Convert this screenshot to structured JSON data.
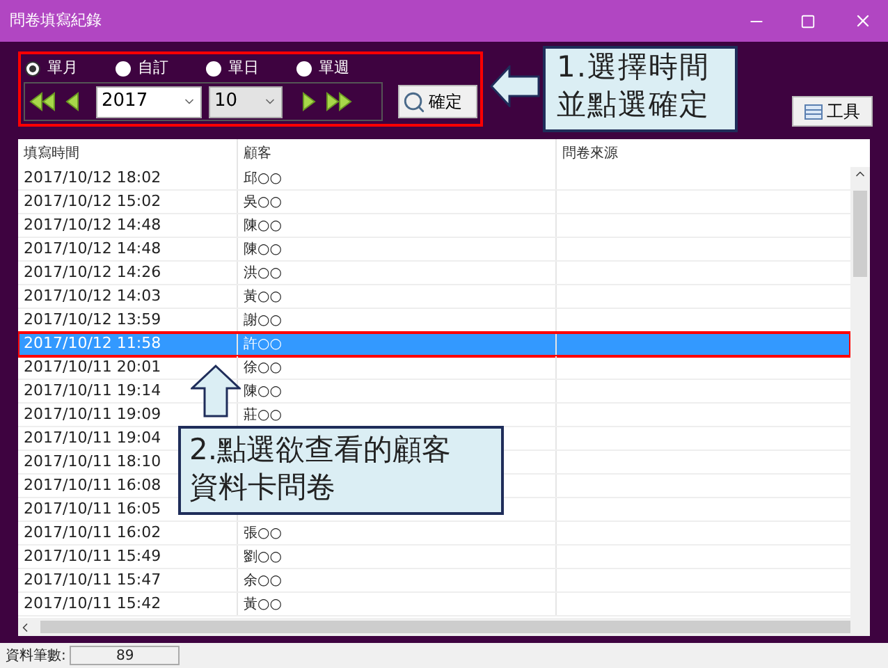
{
  "window": {
    "title": "問卷填寫紀錄"
  },
  "period_options": [
    {
      "label": "單月",
      "selected": true
    },
    {
      "label": "自訂",
      "selected": false
    },
    {
      "label": "單日",
      "selected": false
    },
    {
      "label": "單週",
      "selected": false
    }
  ],
  "year": {
    "value": "2017"
  },
  "month": {
    "value": "10"
  },
  "confirm_button": "確定",
  "tools_button": "工具",
  "table": {
    "columns": [
      "填寫時間",
      "顧客",
      "問卷來源"
    ],
    "rows": [
      {
        "time": "2017/10/12 18:02",
        "customer": "邱○○",
        "selected": false
      },
      {
        "time": "2017/10/12 15:02",
        "customer": "吳○○",
        "selected": false
      },
      {
        "time": "2017/10/12 14:48",
        "customer": "陳○○",
        "selected": false
      },
      {
        "time": "2017/10/12 14:48",
        "customer": "陳○○",
        "selected": false
      },
      {
        "time": "2017/10/12 14:26",
        "customer": "洪○○",
        "selected": false
      },
      {
        "time": "2017/10/12 14:03",
        "customer": "黃○○",
        "selected": false
      },
      {
        "time": "2017/10/12 13:59",
        "customer": "謝○○",
        "selected": false
      },
      {
        "time": "2017/10/12 11:58",
        "customer": "許○○",
        "selected": true
      },
      {
        "time": "2017/10/11 20:01",
        "customer": "徐○○",
        "selected": false
      },
      {
        "time": "2017/10/11 19:14",
        "customer": "陳○○",
        "selected": false
      },
      {
        "time": "2017/10/11 19:09",
        "customer": "莊○○",
        "selected": false
      },
      {
        "time": "2017/10/11 19:04",
        "selected": false
      },
      {
        "time": "2017/10/11 18:10",
        "selected": false
      },
      {
        "time": "2017/10/11 16:08",
        "selected": false
      },
      {
        "time": "2017/10/11 16:05",
        "selected": false
      },
      {
        "time": "2017/10/11 16:02",
        "customer": "張○○",
        "selected": false
      },
      {
        "time": "2017/10/11 15:49",
        "customer": "劉○○",
        "selected": false
      },
      {
        "time": "2017/10/11 15:47",
        "customer": "余○○",
        "selected": false
      },
      {
        "time": "2017/10/11 15:42",
        "customer": "黃○○",
        "selected": false
      }
    ]
  },
  "status_bar": {
    "label": "資料筆數:",
    "count": "89"
  },
  "callouts": [
    {
      "lines": [
        "1.選擇時間",
        "並點選確定"
      ]
    },
    {
      "lines": [
        "2.點選欲查看的顧客",
        "資料卡問卷"
      ]
    }
  ]
}
